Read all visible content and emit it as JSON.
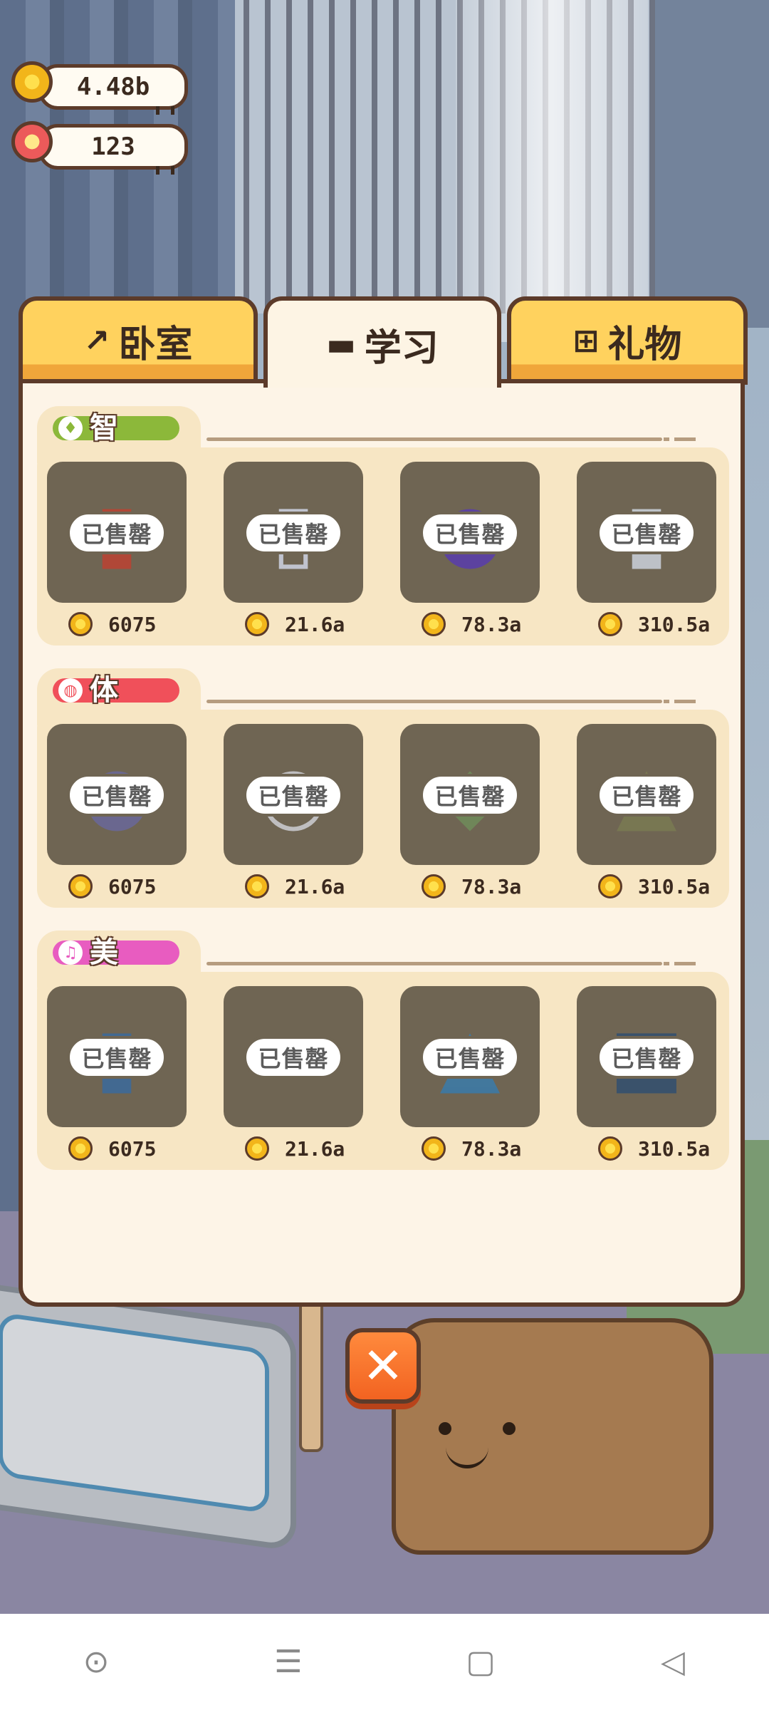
{
  "currency": {
    "coins": "4.48b",
    "flowers": "123"
  },
  "tabs": [
    {
      "label": "卧室",
      "icon": "hammer-icon",
      "active": false
    },
    {
      "label": "学习",
      "icon": "graduation-cap-icon",
      "active": true
    },
    {
      "label": "礼物",
      "icon": "gift-icon",
      "active": false
    }
  ],
  "sections": [
    {
      "label": "智",
      "icon": "lightbulb-icon",
      "color": "#8cb83a",
      "items": [
        {
          "name": "book-item",
          "status": "已售罄",
          "price": "6075"
        },
        {
          "name": "flyer-item",
          "status": "已售罄",
          "price": "21.6a"
        },
        {
          "name": "teletubby-toy-item",
          "status": "已售罄",
          "price": "78.3a"
        },
        {
          "name": "can-item",
          "status": "已售罄",
          "price": "310.5a"
        }
      ]
    },
    {
      "label": "体",
      "icon": "basketball-icon",
      "color": "#f0505a",
      "items": [
        {
          "name": "ball-item",
          "status": "已售罄",
          "price": "6075"
        },
        {
          "name": "cat-bed-item",
          "status": "已售罄",
          "price": "21.6a"
        },
        {
          "name": "mat-item",
          "status": "已售罄",
          "price": "78.3a"
        },
        {
          "name": "swing-item",
          "status": "已售罄",
          "price": "310.5a"
        }
      ]
    },
    {
      "label": "美",
      "icon": "music-note-icon",
      "color": "#e85cc0",
      "items": [
        {
          "name": "picture-book-item",
          "status": "已售罄",
          "price": "6075"
        },
        {
          "name": "tray-item",
          "status": "已售罄",
          "price": "21.6a"
        },
        {
          "name": "vase-item",
          "status": "已售罄",
          "price": "78.3a"
        },
        {
          "name": "stroller-item",
          "status": "已售罄",
          "price": "310.5a"
        }
      ]
    }
  ],
  "colors": {
    "tab_inactive": "#ffd25e",
    "panel_bg": "#fdf4e7",
    "outline": "#5c3b2a",
    "close_button": "#f26321"
  }
}
